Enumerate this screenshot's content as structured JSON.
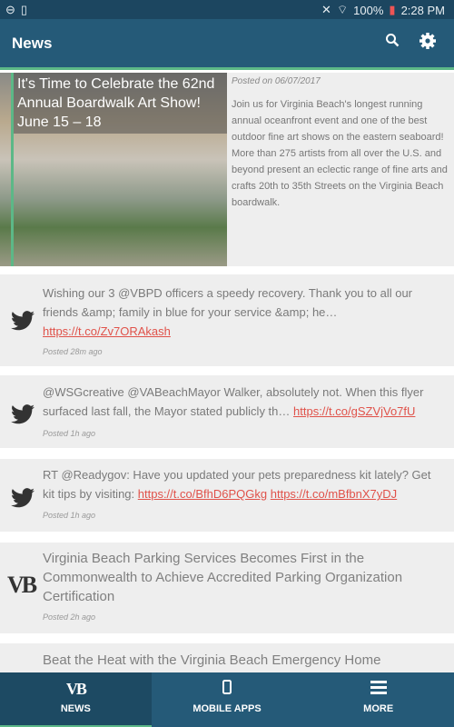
{
  "status": {
    "battery": "100%",
    "time": "2:28 PM"
  },
  "appbar": {
    "title": "News",
    "search_icon": "search-icon",
    "settings_icon": "gear-icon"
  },
  "feature": {
    "title": "It's Time to Celebrate the 62nd Annual Boardwalk Art Show! June 15 – 18",
    "date": "Posted on 06/07/2017",
    "body": "Join us for Virginia Beach's longest running annual oceanfront event and one of the best outdoor fine art shows on the eastern seaboard! More than 275 artists from all over the U.S. and beyond present an eclectic range of fine arts and crafts 20th to 35th Streets on the Virginia Beach boardwalk."
  },
  "items": [
    {
      "text": "Wishing our 3 @VBPD officers a speedy recovery. Thank you to all our friends &amp; family in blue for your service &amp; he… ",
      "links": [
        "https://t.co/Zv7ORAkash"
      ],
      "posted": "Posted 28m ago",
      "icon": "twitter-icon"
    },
    {
      "text": "@WSGcreative @VABeachMayor Walker, absolutely not. When this flyer surfaced last fall, the Mayor stated publicly th… ",
      "links": [
        "https://t.co/gSZVjVo7fU"
      ],
      "posted": "Posted 1h ago",
      "icon": "twitter-icon"
    },
    {
      "text": "RT @Readygov: Have you updated your pets preparedness kit lately? Get kit tips by visiting: ",
      "links": [
        "https://t.co/BfhD6PQGkg",
        "https://t.co/mBfbnX7yDJ"
      ],
      "posted": "Posted 1h ago",
      "icon": "twitter-icon"
    },
    {
      "text": "Virginia Beach Parking Services Becomes First in the Commonwealth to Achieve Accredited Parking Organization Certification",
      "posted": "Posted 2h ago",
      "icon": "vb-logo",
      "logo": "VB"
    },
    {
      "text": "Beat the Heat with the Virginia Beach Emergency Home"
    }
  ],
  "nav": [
    {
      "label": "NEWS",
      "icon": "vb-logo",
      "logo": "VB",
      "active": true
    },
    {
      "label": "MOBILE APPS",
      "icon": "phone-icon"
    },
    {
      "label": "MORE",
      "icon": "menu-icon"
    }
  ],
  "colors": {
    "appbar": "#255a78",
    "accent": "#5cb887",
    "link": "#e0524a"
  }
}
